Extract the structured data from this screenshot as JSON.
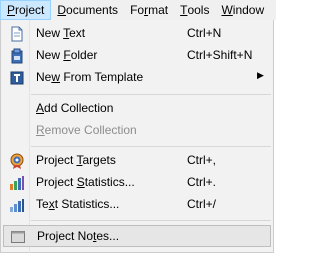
{
  "menubar": {
    "items": [
      {
        "name": "Project",
        "mnemonic": "P",
        "rest": "roject",
        "active": true
      },
      {
        "name": "Documents",
        "mnemonic": "D",
        "rest": "ocuments",
        "active": false
      },
      {
        "name": "Format",
        "pre": "Fo",
        "mnemonic": "r",
        "rest": "mat",
        "active": false
      },
      {
        "name": "Tools",
        "mnemonic": "T",
        "rest": "ools",
        "active": false
      },
      {
        "name": "Window",
        "mnemonic": "W",
        "rest": "indow",
        "active": false
      }
    ]
  },
  "menu": {
    "new_text": {
      "pre": "New ",
      "mn": "T",
      "post": "ext",
      "accel": "Ctrl+N",
      "icon": "new-text-icon"
    },
    "new_folder": {
      "pre": "New ",
      "mn": "F",
      "post": "older",
      "accel": "Ctrl+Shift+N",
      "icon": "new-folder-icon"
    },
    "new_from_template": {
      "pre": "Ne",
      "mn": "w",
      "post": " From Template",
      "accel": "",
      "icon": "template-icon",
      "arrow": "▶"
    },
    "add_collection": {
      "pre": "",
      "mn": "A",
      "post": "dd Collection",
      "accel": ""
    },
    "remove_collection": {
      "pre": "",
      "mn": "R",
      "post": "emove Collection",
      "accel": "",
      "disabled": true
    },
    "project_targets": {
      "pre": "Project ",
      "mn": "T",
      "post": "argets",
      "accel": "Ctrl+,",
      "icon": "target-icon"
    },
    "project_statistics": {
      "pre": "Project ",
      "mn": "S",
      "post": "tatistics...",
      "accel": "Ctrl+.",
      "icon": "bar-chart-icon"
    },
    "text_statistics": {
      "pre": "Te",
      "mn": "x",
      "post": "t Statistics...",
      "accel": "Ctrl+/",
      "icon": "bar-chart-light-icon"
    },
    "project_notes": {
      "pre": "Project No",
      "mn": "t",
      "post": "es...",
      "accel": "",
      "icon": "notes-icon",
      "hovered": true
    }
  },
  "colors": {
    "menubar_bg": "#f0f0f0",
    "menu_bg": "#f2f2f2",
    "active_highlight": "#cce8ff",
    "disabled_text": "#8d8d8d"
  }
}
